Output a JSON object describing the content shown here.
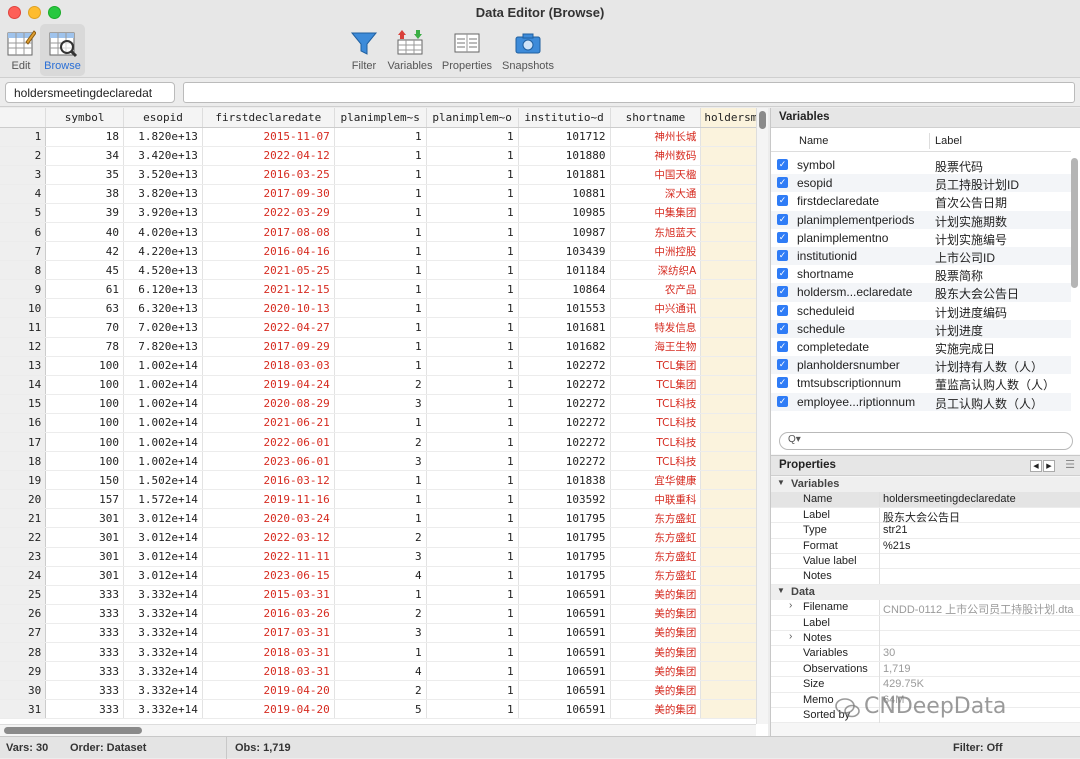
{
  "window": {
    "title": "Data Editor (Browse)"
  },
  "toolbar": {
    "edit": "Edit",
    "browse": "Browse",
    "filter": "Filter",
    "variables": "Variables",
    "properties": "Properties",
    "snapshots": "Snapshots"
  },
  "filterbar": {
    "varname": "holdersmeetingdeclaredat",
    "value": ""
  },
  "grid": {
    "columns": [
      "symbol",
      "esopid",
      "firstdeclaredate",
      "planimplem~s",
      "planimplem~o",
      "institutio~d",
      "shortname",
      "holdersmi"
    ],
    "rows": [
      [
        "1",
        "18",
        "1.820e+13",
        "2015-11-07",
        "1",
        "1",
        "101712",
        "神州长城"
      ],
      [
        "2",
        "34",
        "3.420e+13",
        "2022-04-12",
        "1",
        "1",
        "101880",
        "神州数码"
      ],
      [
        "3",
        "35",
        "3.520e+13",
        "2016-03-25",
        "1",
        "1",
        "101881",
        "中国天楹"
      ],
      [
        "4",
        "38",
        "3.820e+13",
        "2017-09-30",
        "1",
        "1",
        "10881",
        "深大通"
      ],
      [
        "5",
        "39",
        "3.920e+13",
        "2022-03-29",
        "1",
        "1",
        "10985",
        "中集集团"
      ],
      [
        "6",
        "40",
        "4.020e+13",
        "2017-08-08",
        "1",
        "1",
        "10987",
        "东旭蓝天"
      ],
      [
        "7",
        "42",
        "4.220e+13",
        "2016-04-16",
        "1",
        "1",
        "103439",
        "中洲控股"
      ],
      [
        "8",
        "45",
        "4.520e+13",
        "2021-05-25",
        "1",
        "1",
        "101184",
        "深纺织A"
      ],
      [
        "9",
        "61",
        "6.120e+13",
        "2021-12-15",
        "1",
        "1",
        "10864",
        "农产品"
      ],
      [
        "10",
        "63",
        "6.320e+13",
        "2020-10-13",
        "1",
        "1",
        "101553",
        "中兴通讯"
      ],
      [
        "11",
        "70",
        "7.020e+13",
        "2022-04-27",
        "1",
        "1",
        "101681",
        "特发信息"
      ],
      [
        "12",
        "78",
        "7.820e+13",
        "2017-09-29",
        "1",
        "1",
        "101682",
        "海王生物"
      ],
      [
        "13",
        "100",
        "1.002e+14",
        "2018-03-03",
        "1",
        "1",
        "102272",
        "TCL集团"
      ],
      [
        "14",
        "100",
        "1.002e+14",
        "2019-04-24",
        "2",
        "1",
        "102272",
        "TCL集团"
      ],
      [
        "15",
        "100",
        "1.002e+14",
        "2020-08-29",
        "3",
        "1",
        "102272",
        "TCL科技"
      ],
      [
        "16",
        "100",
        "1.002e+14",
        "2021-06-21",
        "1",
        "1",
        "102272",
        "TCL科技"
      ],
      [
        "17",
        "100",
        "1.002e+14",
        "2022-06-01",
        "2",
        "1",
        "102272",
        "TCL科技"
      ],
      [
        "18",
        "100",
        "1.002e+14",
        "2023-06-01",
        "3",
        "1",
        "102272",
        "TCL科技"
      ],
      [
        "19",
        "150",
        "1.502e+14",
        "2016-03-12",
        "1",
        "1",
        "101838",
        "宜华健康"
      ],
      [
        "20",
        "157",
        "1.572e+14",
        "2019-11-16",
        "1",
        "1",
        "103592",
        "中联重科"
      ],
      [
        "21",
        "301",
        "3.012e+14",
        "2020-03-24",
        "1",
        "1",
        "101795",
        "东方盛虹"
      ],
      [
        "22",
        "301",
        "3.012e+14",
        "2022-03-12",
        "2",
        "1",
        "101795",
        "东方盛虹"
      ],
      [
        "23",
        "301",
        "3.012e+14",
        "2022-11-11",
        "3",
        "1",
        "101795",
        "东方盛虹"
      ],
      [
        "24",
        "301",
        "3.012e+14",
        "2023-06-15",
        "4",
        "1",
        "101795",
        "东方盛虹"
      ],
      [
        "25",
        "333",
        "3.332e+14",
        "2015-03-31",
        "1",
        "1",
        "106591",
        "美的集团"
      ],
      [
        "26",
        "333",
        "3.332e+14",
        "2016-03-26",
        "2",
        "1",
        "106591",
        "美的集团"
      ],
      [
        "27",
        "333",
        "3.332e+14",
        "2017-03-31",
        "3",
        "1",
        "106591",
        "美的集团"
      ],
      [
        "28",
        "333",
        "3.332e+14",
        "2018-03-31",
        "1",
        "1",
        "106591",
        "美的集团"
      ],
      [
        "29",
        "333",
        "3.332e+14",
        "2018-03-31",
        "4",
        "1",
        "106591",
        "美的集团"
      ],
      [
        "30",
        "333",
        "3.332e+14",
        "2019-04-20",
        "2",
        "1",
        "106591",
        "美的集团"
      ],
      [
        "31",
        "333",
        "3.332e+14",
        "2019-04-20",
        "5",
        "1",
        "106591",
        "美的集团"
      ]
    ]
  },
  "variables_panel": {
    "title": "Variables",
    "col_name": "Name",
    "col_label": "Label",
    "items": [
      {
        "name": "symbol",
        "label": "股票代码"
      },
      {
        "name": "esopid",
        "label": "员工持股计划ID"
      },
      {
        "name": "firstdeclaredate",
        "label": "首次公告日期"
      },
      {
        "name": "planimplementperiods",
        "label": "计划实施期数"
      },
      {
        "name": "planimplementno",
        "label": "计划实施编号"
      },
      {
        "name": "institutionid",
        "label": "上市公司ID"
      },
      {
        "name": "shortname",
        "label": "股票简称"
      },
      {
        "name": "holdersm...eclaredate",
        "label": "股东大会公告日"
      },
      {
        "name": "scheduleid",
        "label": "计划进度编码"
      },
      {
        "name": "schedule",
        "label": "计划进度"
      },
      {
        "name": "completedate",
        "label": "实施完成日"
      },
      {
        "name": "planholdersnumber",
        "label": "计划持有人数（人）"
      },
      {
        "name": "tmtsubscriptionnum",
        "label": "董监高认购人数（人）"
      },
      {
        "name": "employee...riptionnum",
        "label": "员工认购人数（人）"
      }
    ],
    "search_icon": "Q▾"
  },
  "properties_panel": {
    "title": "Properties",
    "section_variables": "Variables",
    "section_data": "Data",
    "variables": [
      {
        "key": "Name",
        "value": "holdersmeetingdeclaredate"
      },
      {
        "key": "Label",
        "value": "股东大会公告日"
      },
      {
        "key": "Type",
        "value": "str21"
      },
      {
        "key": "Format",
        "value": "%21s"
      },
      {
        "key": "Value label",
        "value": ""
      },
      {
        "key": "Notes",
        "value": ""
      }
    ],
    "data": [
      {
        "key": "Filename",
        "value": "CNDD-0112 上市公司员工持股计划.dta"
      },
      {
        "key": "Label",
        "value": ""
      },
      {
        "key": "Notes",
        "value": ""
      },
      {
        "key": "Variables",
        "value": "30"
      },
      {
        "key": "Observations",
        "value": "1,719"
      },
      {
        "key": "Size",
        "value": "429.75K"
      },
      {
        "key": "Memo",
        "value": "64M"
      },
      {
        "key": "Sorted by",
        "value": ""
      }
    ]
  },
  "statusbar": {
    "vars": "Vars: 30",
    "order": "Order: Dataset",
    "obs": "Obs: 1,719",
    "filter": "Filter: Off"
  },
  "watermark": "CNDeepData"
}
